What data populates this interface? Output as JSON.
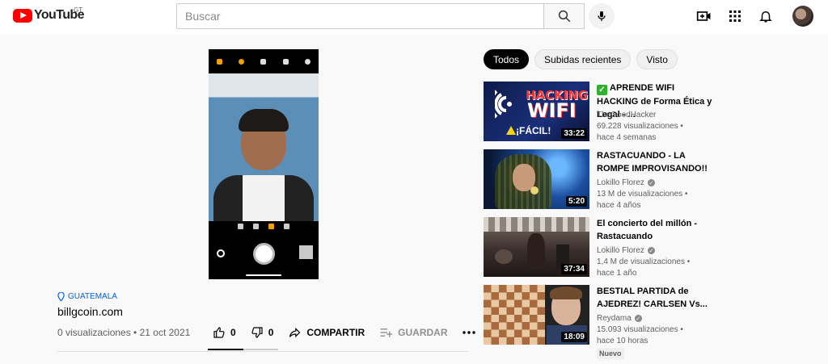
{
  "header": {
    "logo_text": "YouTube",
    "country_code": "GT",
    "search_placeholder": "Buscar",
    "icons": [
      "search-icon",
      "mic-icon",
      "create-video-icon",
      "apps-grid-icon",
      "bell-icon",
      "avatar"
    ]
  },
  "video": {
    "location": "GUATEMALA",
    "title": "billgcoin.com",
    "meta": "0 visualizaciones • 21 oct 2021",
    "likes": "0",
    "dislikes": "0",
    "share_label": "COMPARTIR",
    "save_label": "GUARDAR",
    "like_ratio": 0.5
  },
  "chips": [
    "Todos",
    "Subidas recientes",
    "Visto"
  ],
  "recommendations": [
    {
      "title": "APRENDE WIFI HACKING de Forma Ética y Legal - ...",
      "channel": "TheGoodHacker",
      "views": "69.228 visualizaciones •",
      "age": "hace 4 semanas",
      "duration": "33:22",
      "thumb_text_1": "HACKING",
      "thumb_text_2": "WIFI",
      "thumb_text_3": "¡FÁCIL!",
      "verified": false,
      "check": true
    },
    {
      "title": "RASTACUANDO - LA ROMPE IMPROVISANDO!!",
      "channel": "Lokillo Florez",
      "views": "13 M de visualizaciones •",
      "age": "hace 4 años",
      "duration": "5:20",
      "verified": true
    },
    {
      "title": "El concierto del millón - Rastacuando",
      "channel": "Lokillo Florez",
      "views": "1,4 M de visualizaciones •",
      "age": "hace 1 año",
      "duration": "37:34",
      "verified": true
    },
    {
      "title": "BESTIAL PARTIDA de AJEDREZ! CARLSEN Vs...",
      "channel": "Reydama",
      "views": "15.093 visualizaciones •",
      "age": "hace 10 horas",
      "duration": "18:09",
      "badge": "Nuevo",
      "verified": true
    }
  ]
}
